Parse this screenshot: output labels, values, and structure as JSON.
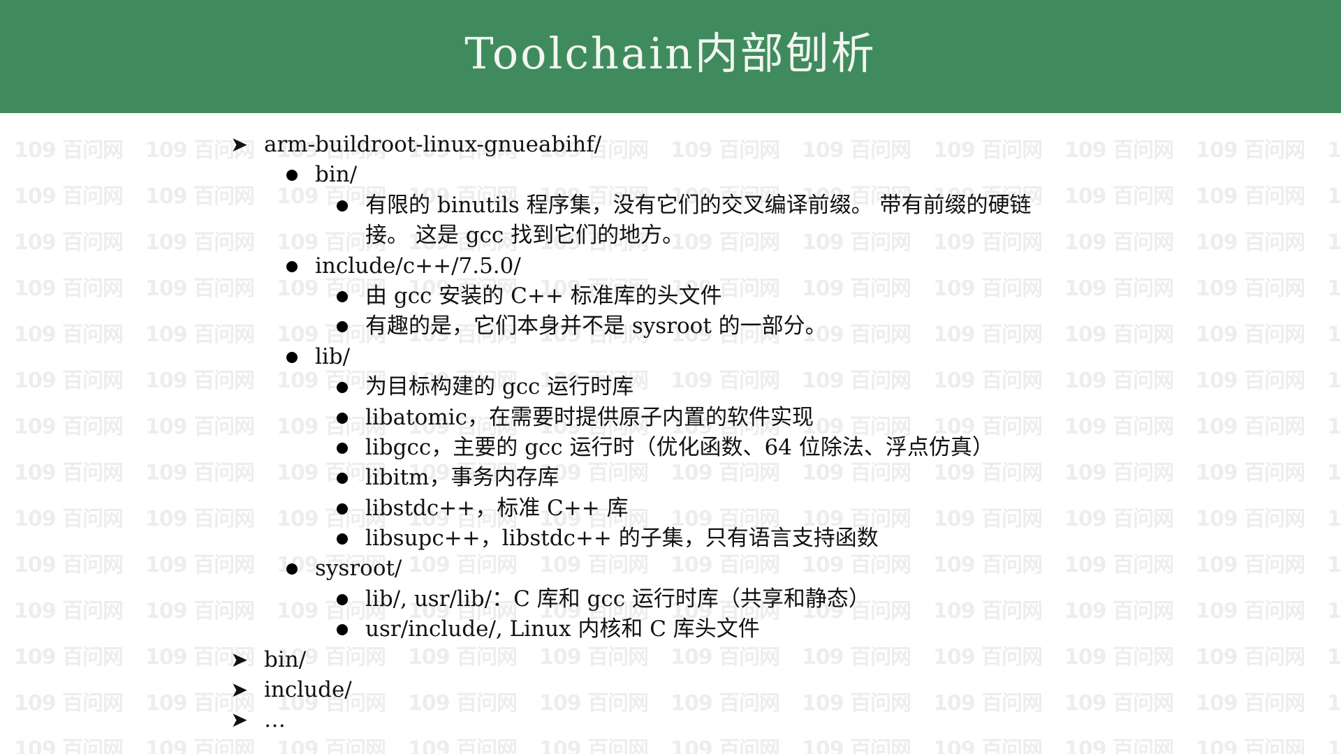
{
  "slide": {
    "title": "Toolchain内部刨析",
    "header_color": "#3f8b5d",
    "watermark_text": "109 百问网"
  },
  "outline": {
    "item0": "arm-buildroot-linux-gnueabihf/",
    "bin_dir": "bin/",
    "bin_note_1": "有限的 binutils 程序集，没有它们的交叉编译前缀。 带有前缀的硬链",
    "bin_note_1_cont": "接。 这是 gcc 找到它们的地方。",
    "include_dir": "include/c++/7.5.0/",
    "include_note_1": "由 gcc 安装的 C++ 标准库的头文件",
    "include_note_2": "有趣的是，它们本身并不是 sysroot 的一部分。",
    "lib_dir": "lib/",
    "lib_note_1": "为目标构建的 gcc 运行时库",
    "lib_note_2": "libatomic，在需要时提供原子内置的软件实现",
    "lib_note_3": "libgcc，主要的 gcc 运行时（优化函数、64 位除法、浮点仿真）",
    "lib_note_4": "libitm，事务内存库",
    "lib_note_5": "libstdc++，标准 C++ 库",
    "lib_note_6": "libsupc++，libstdc++ 的子集，只有语言支持函数",
    "sysroot_dir": "sysroot/",
    "sysroot_note_1": "lib/, usr/lib/：C 库和 gcc 运行时库（共享和静态）",
    "sysroot_note_2": "usr/include/, Linux 内核和 C 库头文件",
    "item1": "bin/",
    "item2": "include/",
    "item3": "…"
  }
}
